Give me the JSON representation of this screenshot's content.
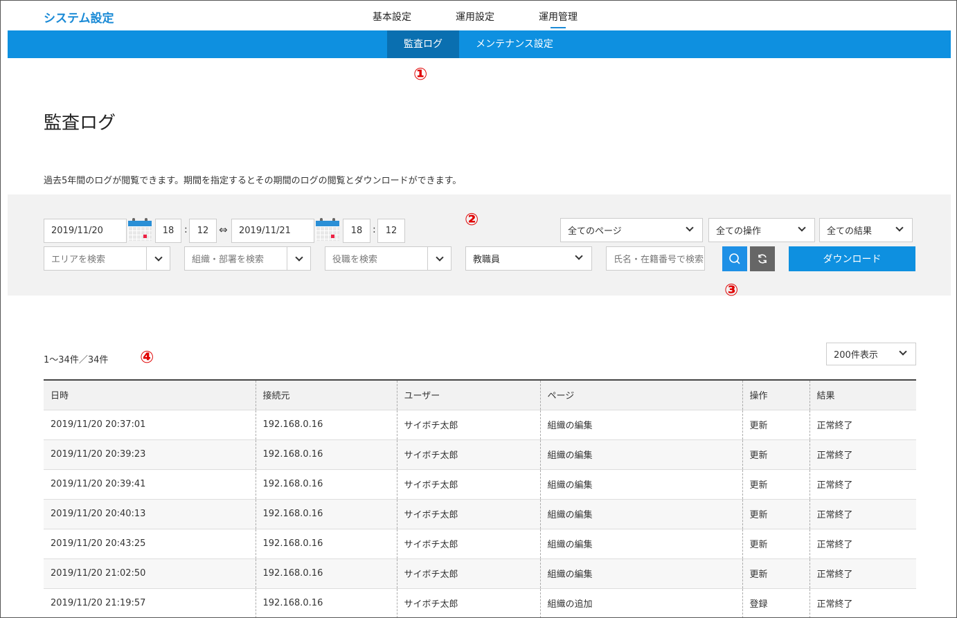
{
  "header": {
    "logo": "システム設定",
    "nav": [
      {
        "label": "基本設定"
      },
      {
        "label": "運用設定"
      },
      {
        "label": "運用管理"
      }
    ],
    "subnav": [
      {
        "label": "監査ログ"
      },
      {
        "label": "メンテナンス設定"
      }
    ]
  },
  "markers": {
    "m1": "①",
    "m2": "②",
    "m3": "③",
    "m4": "④"
  },
  "page": {
    "title": "監査ログ",
    "description": "過去5年間のログが閲覧できます。期間を指定するとその期間のログの閲覧とダウンロードができます。"
  },
  "filters": {
    "start_date": "2019/11/20",
    "start_hour": "18",
    "start_min": "12",
    "range_symbol": "⇔",
    "end_date": "2019/11/21",
    "end_hour": "18",
    "end_min": "12",
    "colon": ":",
    "page_select": "全てのページ",
    "operation_select": "全ての操作",
    "result_select": "全ての結果",
    "area_placeholder": "エリアを検索",
    "org_placeholder": "組織・部署を検索",
    "position_placeholder": "役職を検索",
    "role_select": "教職員",
    "name_placeholder": "氏名・在籍番号で検索",
    "download_label": "ダウンロード"
  },
  "list": {
    "count": "1〜34件／34件",
    "per_page": "200件表示",
    "columns": [
      "日時",
      "接続元",
      "ユーザー",
      "ページ",
      "操作",
      "結果"
    ],
    "rows": [
      [
        "2019/11/20 20:37:01",
        "192.168.0.16",
        "サイボチ太郎",
        "組織の編集",
        "更新",
        "正常終了"
      ],
      [
        "2019/11/20 20:39:23",
        "192.168.0.16",
        "サイボチ太郎",
        "組織の編集",
        "更新",
        "正常終了"
      ],
      [
        "2019/11/20 20:39:41",
        "192.168.0.16",
        "サイボチ太郎",
        "組織の編集",
        "更新",
        "正常終了"
      ],
      [
        "2019/11/20 20:40:13",
        "192.168.0.16",
        "サイボチ太郎",
        "組織の編集",
        "更新",
        "正常終了"
      ],
      [
        "2019/11/20 20:43:25",
        "192.168.0.16",
        "サイボチ太郎",
        "組織の編集",
        "更新",
        "正常終了"
      ],
      [
        "2019/11/20 21:02:50",
        "192.168.0.16",
        "サイボチ太郎",
        "組織の編集",
        "更新",
        "正常終了"
      ],
      [
        "2019/11/20 21:19:57",
        "192.168.0.16",
        "サイボチ太郎",
        "組織の追加",
        "登録",
        "正常終了"
      ]
    ]
  },
  "icons": {
    "calendar": "calendar-icon",
    "search": "search-icon",
    "reset": "refresh-icon",
    "chevron": "chevron-down-icon"
  },
  "colors": {
    "brand": "#1a8ad6",
    "subnav_bg": "#0e90e0",
    "subnav_active": "#0a6fb0",
    "marker": "#e00000"
  }
}
